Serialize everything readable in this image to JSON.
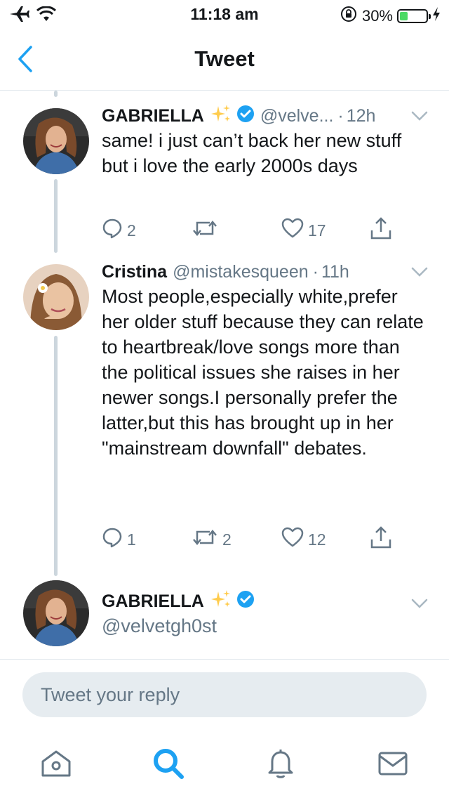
{
  "status_bar": {
    "time": "11:18 am",
    "battery_percent": "30%",
    "battery_level": 0.3,
    "icons": [
      "airplane-icon",
      "wifi-icon",
      "rotation-lock-icon",
      "battery-icon",
      "charging-icon"
    ]
  },
  "nav": {
    "title": "Tweet",
    "back_icon": "chevron-left-icon"
  },
  "colors": {
    "accent": "#1da1f2",
    "text": "#14171a",
    "muted": "#657786",
    "thread_line": "#ccd6dd",
    "input_bg": "#e6ecf0",
    "battery_green": "#4cd964"
  },
  "tweets": [
    {
      "name": "GABRIELLA",
      "handle": "@velve...",
      "separator": "·",
      "age": "12h",
      "text": "same! i just can’t back her new stuff but i love the early 2000s days",
      "replies": "2",
      "retweets": "",
      "likes": "17"
    },
    {
      "name": "Cristina",
      "handle": "@mistakesqueen",
      "separator": "·",
      "age": "11h",
      "text": "Most people,especially white,prefer her older stuff because they can relate to heartbreak/love songs more than the political issues she raises in her newer songs.I personally prefer the latter,but this has brought up in her \"mainstream downfall\" debates.",
      "replies": "1",
      "retweets": "2",
      "likes": "12"
    },
    {
      "name": "GABRIELLA",
      "handle": "@velvetgh0st"
    }
  ],
  "reply": {
    "placeholder": "Tweet your reply"
  },
  "tabs": [
    "home-icon",
    "search-icon",
    "notifications-icon",
    "messages-icon"
  ]
}
